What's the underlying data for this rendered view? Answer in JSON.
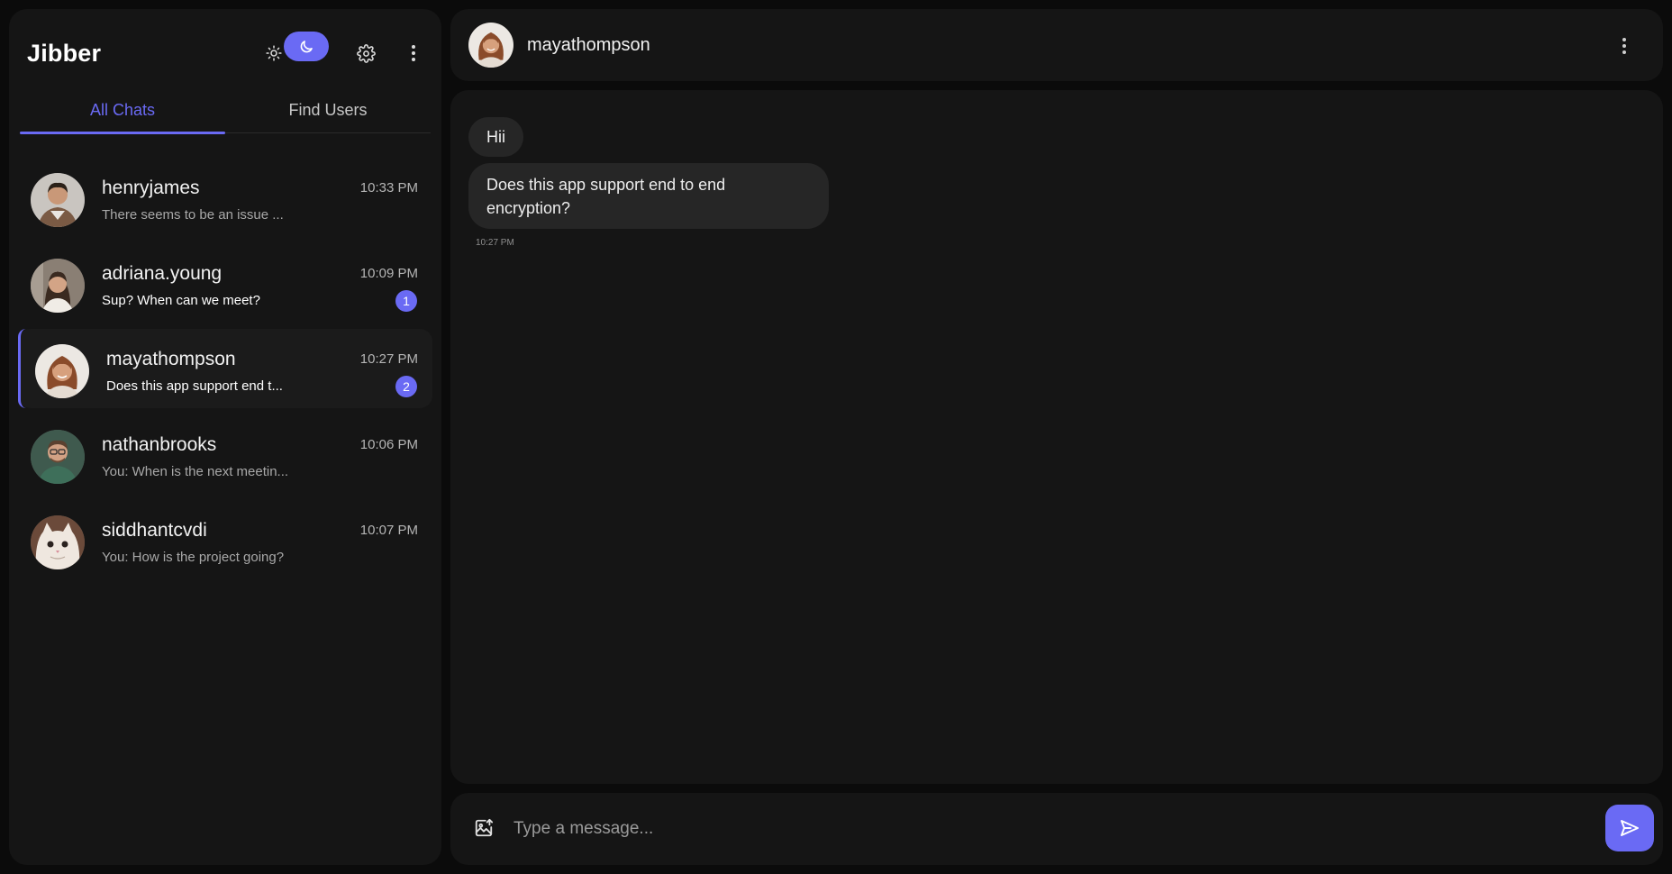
{
  "app": {
    "title": "Jibber"
  },
  "colors": {
    "accent": "#6a6af4",
    "panel": "#151515",
    "background": "#0b0b0b"
  },
  "header_icons": [
    "sun-icon",
    "moon-icon",
    "gear-icon",
    "kebab-menu-icon"
  ],
  "tabs": [
    {
      "label": "All Chats",
      "active": true
    },
    {
      "label": "Find Users",
      "active": false
    }
  ],
  "chats": [
    {
      "name": "henryjames",
      "preview": "There seems to be an issue ...",
      "time": "10:33 PM",
      "unread": "",
      "active": false
    },
    {
      "name": "adriana.young",
      "preview": "Sup? When can we meet?",
      "time": "10:09 PM",
      "unread": "1",
      "active": false
    },
    {
      "name": "mayathompson",
      "preview": "Does this app support end t...",
      "time": "10:27 PM",
      "unread": "2",
      "active": true
    },
    {
      "name": "nathanbrooks",
      "preview": "You: When is the next meetin...",
      "time": "10:06 PM",
      "unread": "",
      "active": false
    },
    {
      "name": "siddhantcvdi",
      "preview": "You: How is the project going?",
      "time": "10:07 PM",
      "unread": "",
      "active": false
    }
  ],
  "conversation": {
    "contact_name": "mayathompson",
    "messages": [
      {
        "text": "Hii"
      },
      {
        "text": "Does this app support end to end encryption?"
      }
    ],
    "last_time": "10:27 PM"
  },
  "composer": {
    "placeholder": "Type a message..."
  }
}
